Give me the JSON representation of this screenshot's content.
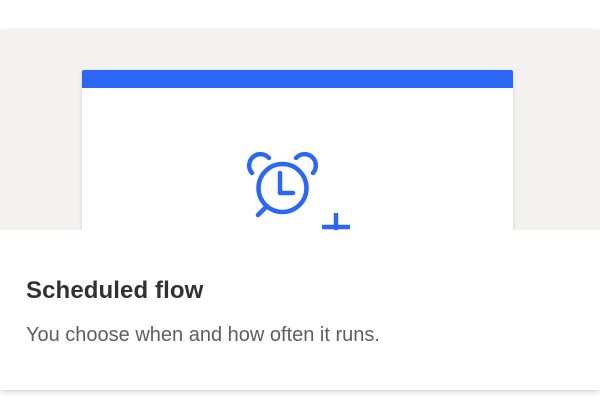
{
  "card": {
    "title": "Scheduled flow",
    "description": "You choose when and how often it runs.",
    "icon": "alarm-clock-add-icon"
  },
  "colors": {
    "accent": "#2b66f5",
    "preview_background": "#f3f2f1",
    "title_text": "#323130",
    "description_text": "#605e5c"
  }
}
